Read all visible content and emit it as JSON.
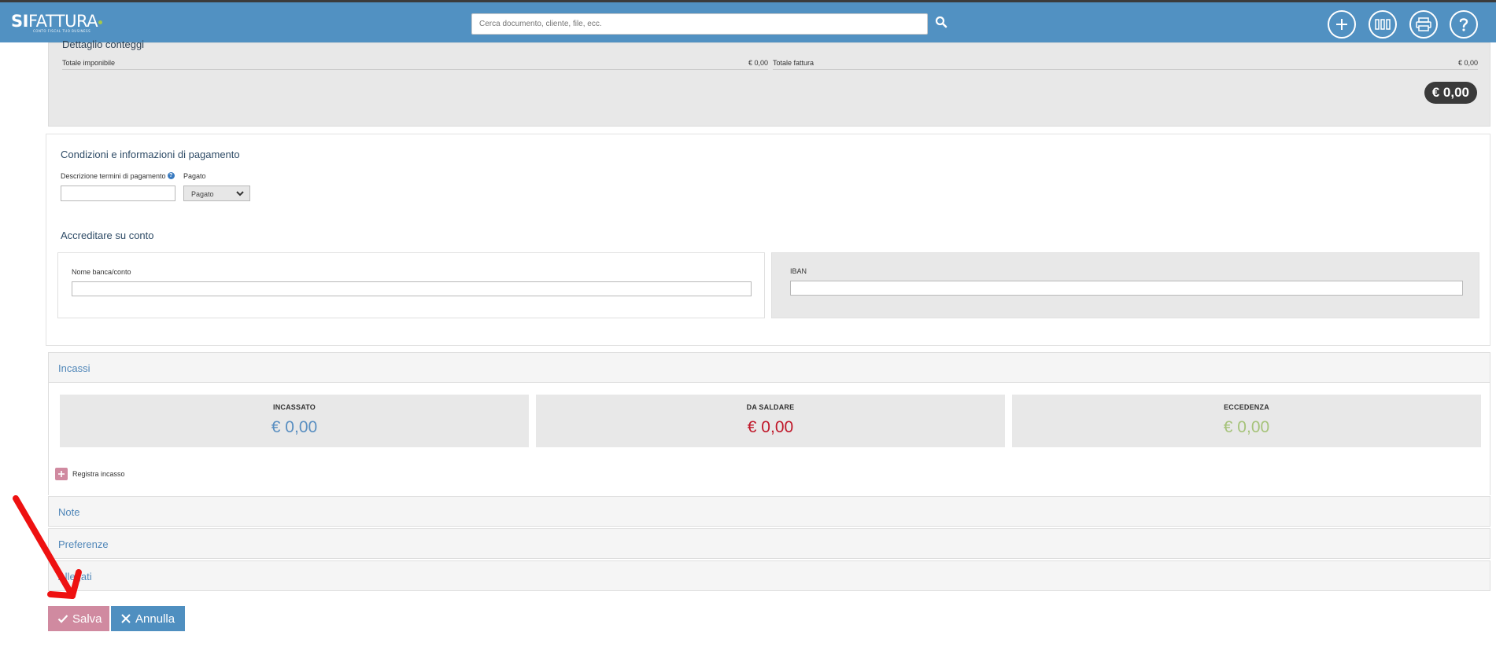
{
  "colors": {
    "topbar": "#5191c2",
    "incassato": "#5a8fc1",
    "da_saldare": "#c0182a",
    "eccedenza": "#a6c37a",
    "salva": "#d08aa0",
    "annulla": "#4f8fc0",
    "annotation_arrow": "#ee1111"
  },
  "header": {
    "logo_bold": "SI",
    "logo_rest": "FATTURA",
    "logo_tagline": "CONTO FISCAL TUO BUSINESS",
    "search_placeholder": "Cerca documento, cliente, file, ecc.",
    "icons": [
      "search-icon",
      "plus-icon",
      "barcode-icon",
      "printer-icon",
      "help-icon"
    ]
  },
  "conteggi": {
    "title": "Dettaglio conteggi",
    "totale_imponibile_label": "Totale imponibile",
    "totale_imponibile_value": "€ 0,00",
    "totale_fattura_label": "Totale fattura",
    "totale_fattura_value": "€ 0,00",
    "total_badge": "€ 0,00"
  },
  "pagamento": {
    "title": "Condizioni e informazioni di pagamento",
    "descrizione_label": "Descrizione termini di pagamento",
    "descrizione_value": "",
    "pagato_label": "Pagato",
    "pagato_selected": "Pagato"
  },
  "conto": {
    "title": "Accreditare su conto",
    "nome_label": "Nome banca/conto",
    "nome_value": "",
    "iban_label": "IBAN",
    "iban_value": ""
  },
  "incassi": {
    "title": "Incassi",
    "kpis": [
      {
        "label": "INCASSATO",
        "value": "€ 0,00"
      },
      {
        "label": "DA SALDARE",
        "value": "€ 0,00"
      },
      {
        "label": "ECCEDENZA",
        "value": "€ 0,00"
      }
    ],
    "registra_label": "Registra incasso"
  },
  "sections": {
    "note": "Note",
    "preferenze": "Preferenze",
    "allegati": "Allegati"
  },
  "actions": {
    "salva": "Salva",
    "annulla": "Annulla"
  }
}
